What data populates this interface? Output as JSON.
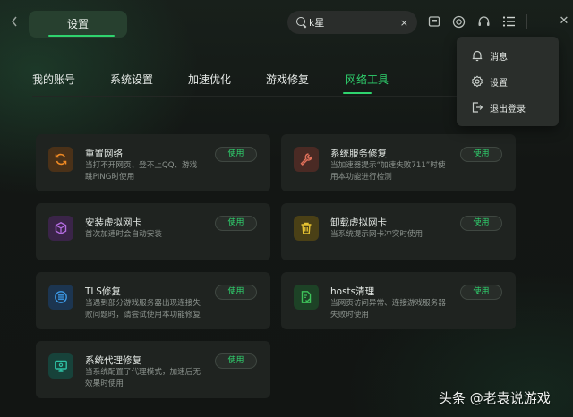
{
  "header": {
    "back_icon": "chevron-left-icon",
    "title": "设置",
    "search": {
      "value": "k星",
      "placeholder": "",
      "clear_label": "×"
    },
    "icons": [
      "store-icon",
      "refresh-circle-icon",
      "headset-icon",
      "menu-list-icon"
    ],
    "window": {
      "minimize": "—",
      "close": "✕"
    }
  },
  "tabs": [
    {
      "label": "我的账号",
      "active": false
    },
    {
      "label": "系统设置",
      "active": false
    },
    {
      "label": "加速优化",
      "active": false
    },
    {
      "label": "游戏修复",
      "active": false
    },
    {
      "label": "网络工具",
      "active": true
    }
  ],
  "tools": [
    {
      "name": "重置网络",
      "desc": "当打不开网页、登不上QQ、游戏跳PING时使用",
      "button": "使用",
      "icon": "reset-icon",
      "color": "#f08a24"
    },
    {
      "name": "系统服务修复",
      "desc": "当加速器提示“加速失败711”时使用本功能进行检测",
      "button": "使用",
      "icon": "wrench-icon",
      "color": "#e0705a"
    },
    {
      "name": "安装虚拟网卡",
      "desc": "首次加速时会自动安装",
      "button": "使用",
      "icon": "cube-icon",
      "color": "#b36ce0"
    },
    {
      "name": "卸载虚拟网卡",
      "desc": "当系统提示网卡冲突时使用",
      "button": "使用",
      "icon": "trash-icon",
      "color": "#e6c232"
    },
    {
      "name": "TLS修复",
      "desc": "当遇到部分游戏服务器出现连接失败问题时，请尝试使用本功能修复",
      "button": "使用",
      "icon": "list-circle-icon",
      "color": "#3d9be8"
    },
    {
      "name": "hosts清理",
      "desc": "当网页访问异常、连接游戏服务器失败时使用",
      "button": "使用",
      "icon": "file-check-icon",
      "color": "#3ec25a"
    },
    {
      "name": "系统代理修复",
      "desc": "当系统配置了代理模式，加速后无效果时使用",
      "button": "使用",
      "icon": "monitor-gear-icon",
      "color": "#2fc2a6"
    }
  ],
  "dropdown_menu": [
    {
      "label": "消息",
      "icon": "bell-icon"
    },
    {
      "label": "设置",
      "icon": "gear-icon"
    },
    {
      "label": "退出登录",
      "icon": "logout-icon"
    }
  ],
  "watermark": "头条 @老袁说游戏",
  "colors": {
    "accent": "#2fd36e",
    "background": "#141715",
    "card": "#1f2320"
  }
}
